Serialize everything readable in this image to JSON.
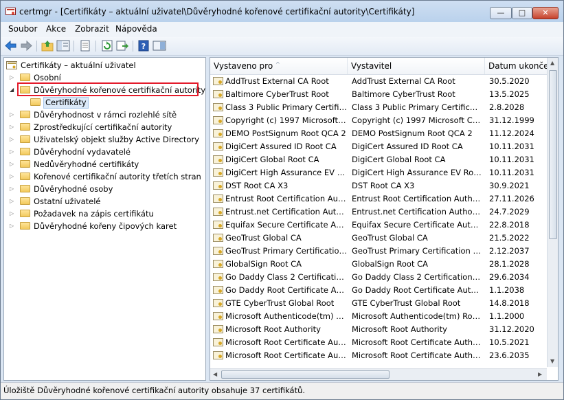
{
  "window": {
    "title": "certmgr - [Certifikáty – aktuální uživatel\\Důvěryhodné kořenové certifikační autority\\Certifikáty]",
    "controls": {
      "minimize": "—",
      "maximize": "□",
      "close": "✕"
    }
  },
  "menu": [
    "Soubor",
    "Akce",
    "Zobrazit",
    "Nápověda"
  ],
  "toolbar_icons": [
    "back-arrow-icon",
    "forward-arrow-icon",
    "up-folder-icon",
    "show-hide-tree-icon",
    "properties-icon",
    "refresh-icon",
    "export-list-icon",
    "help-icon",
    "action-pane-icon"
  ],
  "tree": {
    "root": "Certifikáty – aktuální uživatel",
    "items": [
      {
        "label": "Osobní",
        "expanded": false
      },
      {
        "label": "Důvěryhodné kořenové certifikační autority",
        "expanded": true,
        "child": "Certifikáty"
      },
      {
        "label": "Důvěryhodnost v rámci rozlehlé sítě",
        "expanded": false
      },
      {
        "label": "Zprostředkující certifikační autority",
        "expanded": false
      },
      {
        "label": "Uživatelský objekt služby Active Directory",
        "expanded": false
      },
      {
        "label": "Důvěryhodní vydavatelé",
        "expanded": false
      },
      {
        "label": "Nedůvěryhodné certifikáty",
        "expanded": false
      },
      {
        "label": "Kořenové certifikační autority třetích stran",
        "expanded": false
      },
      {
        "label": "Důvěryhodné osoby",
        "expanded": false
      },
      {
        "label": "Ostatní uživatelé",
        "expanded": false
      },
      {
        "label": "Požadavek na zápis certifikátu",
        "expanded": false
      },
      {
        "label": "Důvěryhodné kořeny čipových karet",
        "expanded": false
      }
    ]
  },
  "list": {
    "headers": [
      "Vystaveno pro",
      "Vystavitel",
      "Datum ukonče..."
    ],
    "rows": [
      [
        "AddTrust External CA Root",
        "AddTrust External CA Root",
        "30.5.2020"
      ],
      [
        "Baltimore CyberTrust Root",
        "Baltimore CyberTrust Root",
        "13.5.2025"
      ],
      [
        "Class 3 Public Primary Certificat...",
        "Class 3 Public Primary Certificatio...",
        "2.8.2028"
      ],
      [
        "Copyright (c) 1997 Microsoft C...",
        "Copyright (c) 1997 Microsoft Corp.",
        "31.12.1999"
      ],
      [
        "DEMO PostSignum Root QCA 2",
        "DEMO PostSignum Root QCA 2",
        "11.12.2024"
      ],
      [
        "DigiCert Assured ID Root CA",
        "DigiCert Assured ID Root CA",
        "10.11.2031"
      ],
      [
        "DigiCert Global Root CA",
        "DigiCert Global Root CA",
        "10.11.2031"
      ],
      [
        "DigiCert High Assurance EV Ro...",
        "DigiCert High Assurance EV Root ...",
        "10.11.2031"
      ],
      [
        "DST Root CA X3",
        "DST Root CA X3",
        "30.9.2021"
      ],
      [
        "Entrust Root Certification Auth...",
        "Entrust Root Certification Authority",
        "27.11.2026"
      ],
      [
        "Entrust.net Certification Author...",
        "Entrust.net Certification Authority...",
        "24.7.2029"
      ],
      [
        "Equifax Secure Certificate Auth...",
        "Equifax Secure Certificate Authority",
        "22.8.2018"
      ],
      [
        "GeoTrust Global CA",
        "GeoTrust Global CA",
        "21.5.2022"
      ],
      [
        "GeoTrust Primary Certification ...",
        "GeoTrust Primary Certification Au...",
        "2.12.2037"
      ],
      [
        "GlobalSign Root CA",
        "GlobalSign Root CA",
        "28.1.2028"
      ],
      [
        "Go Daddy Class 2 Certification ...",
        "Go Daddy Class 2 Certification Au...",
        "29.6.2034"
      ],
      [
        "Go Daddy Root Certificate Auth...",
        "Go Daddy Root Certificate Authori...",
        "1.1.2038"
      ],
      [
        "GTE CyberTrust Global Root",
        "GTE CyberTrust Global Root",
        "14.8.2018"
      ],
      [
        "Microsoft Authenticode(tm) Ro...",
        "Microsoft Authenticode(tm) Root...",
        "1.1.2000"
      ],
      [
        "Microsoft Root Authority",
        "Microsoft Root Authority",
        "31.12.2020"
      ],
      [
        "Microsoft Root Certificate Auth...",
        "Microsoft Root Certificate Authori...",
        "10.5.2021"
      ],
      [
        "Microsoft Root Certificate Auth...",
        "Microsoft Root Certificate Authori...",
        "23.6.2035"
      ]
    ]
  },
  "status": "Úložiště Důvěryhodné kořenové certifikační autority obsahuje 37 certifikátů."
}
